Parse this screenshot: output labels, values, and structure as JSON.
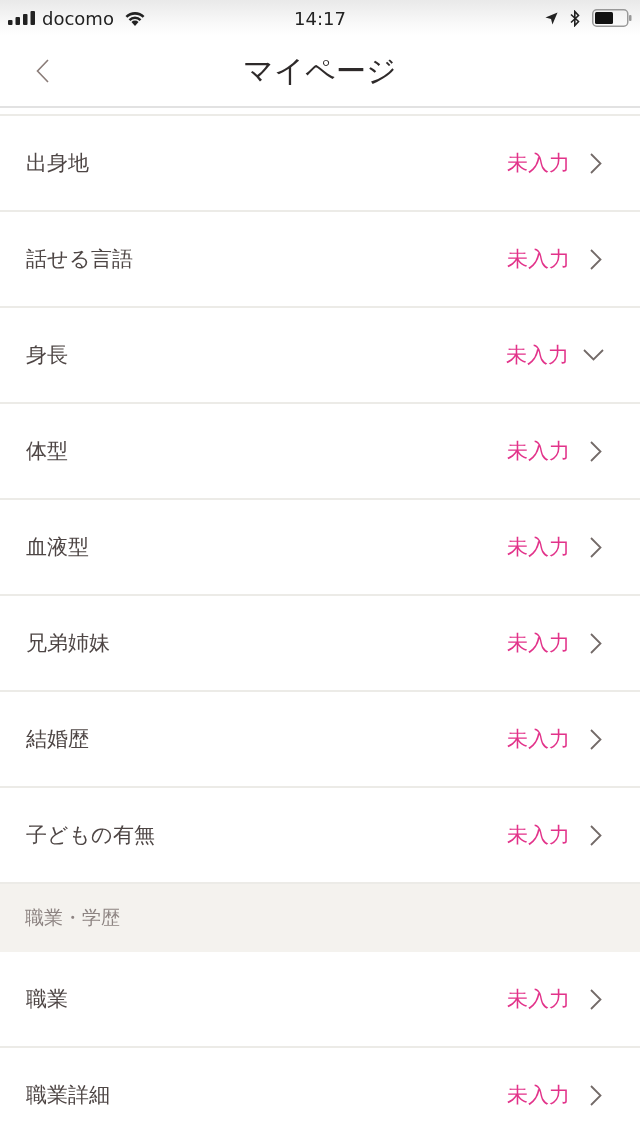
{
  "status_bar": {
    "carrier": "docomo",
    "time": "14:17"
  },
  "nav_bar": {
    "title": "マイページ"
  },
  "items": [
    {
      "kind": "row",
      "label": "出身地",
      "value": "未入力",
      "expanded": false
    },
    {
      "kind": "row",
      "label": "話せる言語",
      "value": "未入力",
      "expanded": false
    },
    {
      "kind": "row",
      "label": "身長",
      "value": "未入力",
      "expanded": true
    },
    {
      "kind": "row",
      "label": "体型",
      "value": "未入力",
      "expanded": false
    },
    {
      "kind": "row",
      "label": "血液型",
      "value": "未入力",
      "expanded": false
    },
    {
      "kind": "row",
      "label": "兄弟姉妹",
      "value": "未入力",
      "expanded": false
    },
    {
      "kind": "row",
      "label": "結婚歴",
      "value": "未入力",
      "expanded": false
    },
    {
      "kind": "row",
      "label": "子どもの有無",
      "value": "未入力",
      "expanded": false
    },
    {
      "kind": "section_header",
      "label": "職業・学歴"
    },
    {
      "kind": "row",
      "label": "職業",
      "value": "未入力",
      "expanded": false
    },
    {
      "kind": "row",
      "label": "職業詳細",
      "value": "未入力",
      "expanded": false
    }
  ]
}
